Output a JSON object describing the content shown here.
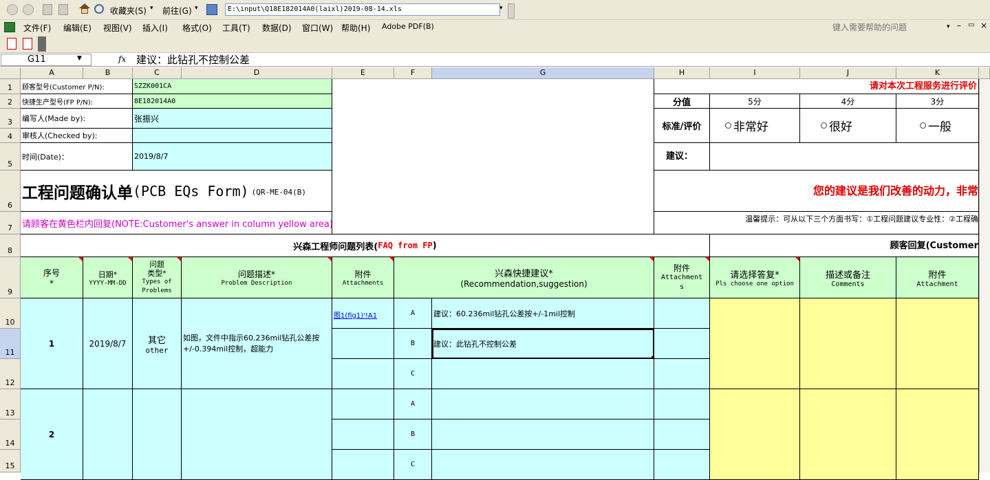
{
  "toolbar": {
    "favorites_label": "收藏夹(S)",
    "goto_label": "前往(G)",
    "path": "E:\\input\\Q18E182014A0(laixl)2019-08-14.xls"
  },
  "menu": [
    "文件(F)",
    "编辑(E)",
    "视图(V)",
    "插入(I)",
    "格式(O)",
    "工具(T)",
    "数据(D)",
    "窗口(W)",
    "帮助(H)",
    "Adobe PDF(B)"
  ],
  "help_placeholder": "键入需要帮助的问题",
  "formula": {
    "name_box": "G11",
    "fx": "fx",
    "content": "建议：此钻孔不控制公差"
  },
  "columns": [
    "A",
    "B",
    "C",
    "D",
    "E",
    "F",
    "G",
    "H",
    "I",
    "J",
    "K"
  ],
  "rows": [
    "1",
    "2",
    "3",
    "4",
    "5",
    "6",
    "7",
    "8",
    "9",
    "10",
    "11",
    "12",
    "13",
    "14",
    "15"
  ],
  "header_info": {
    "customer_pn_label": "顾客型号(Customer P/N):",
    "customer_pn": "SZZK001CA",
    "fp_pn_label": "快捷生产型号(FP P/N):",
    "fp_pn": "8E182014A0",
    "made_by_label": "编写人(Made by):",
    "made_by": "张振兴",
    "checked_by_label": "审核人(Checked by):",
    "checked_by": "",
    "date_label": "时间(Date)：",
    "date": "2019/8/7"
  },
  "form_title_cn": "工程问题确认单",
  "form_title_en": "(PCB EQs Form)",
  "form_code": "(QR-ME-04(B)",
  "notice": "请顾客在黄色栏内回复(NOTE:Customer's answer in column yellow area)",
  "rating": {
    "title": "请对本次工程服务进行评价",
    "score_label": "分值",
    "scores": [
      "5分",
      "4分",
      "3分"
    ],
    "criteria_label": "标准/评价",
    "options": [
      "非常好",
      "很好",
      "一般"
    ],
    "suggestion_label": "建议：",
    "motto": "您的建议是我们改善的动力，非常",
    "tip": "温馨提示：可从以下三个方面书写：①工程问题建议专业性：②工程确"
  },
  "sections": {
    "fp_list": "兴森工程师问题列表(",
    "fp_list_en": "FAQ from FP",
    "fp_list_end": ")",
    "customer_reply": "顾客回复(Customer"
  },
  "table_headers": {
    "seq": [
      "序号",
      "*"
    ],
    "date": [
      "日期*",
      "YYYY-MM-DD"
    ],
    "type": [
      "问题",
      "类型*",
      "Types of",
      "Problems"
    ],
    "desc": [
      "问题描述*",
      "Problem Description"
    ],
    "attach": [
      "附件",
      "Attachments"
    ],
    "recommend": [
      "兴森快捷建议*",
      "(Recommendation,suggestion)"
    ],
    "attach2": [
      "附件",
      "Attachment",
      "s"
    ],
    "choose": [
      "请选择答复*",
      "Pls choose one option"
    ],
    "comments": [
      "描述或备注",
      "Comments"
    ],
    "attach3": [
      "附件",
      "Attachment"
    ]
  },
  "problems": [
    {
      "seq": "1",
      "date": "2019/8/7",
      "type_cn": "其它",
      "type_en": "other",
      "description": "如图，文件中指示60.236mil钻孔公差按+/-0.394mil控制，超能力",
      "attachment": "图1(fig1)'!A1",
      "options": [
        {
          "letter": "A",
          "text": "建议：60.236mil钻孔公差按+/-1mil控制"
        },
        {
          "letter": "B",
          "text": "建议：此钻孔不控制公差"
        },
        {
          "letter": "C",
          "text": ""
        }
      ]
    },
    {
      "seq": "2",
      "date": "",
      "type_cn": "",
      "type_en": "",
      "description": "",
      "attachment": "",
      "options": [
        {
          "letter": "A",
          "text": ""
        },
        {
          "letter": "B",
          "text": ""
        },
        {
          "letter": "C",
          "text": ""
        }
      ]
    }
  ]
}
